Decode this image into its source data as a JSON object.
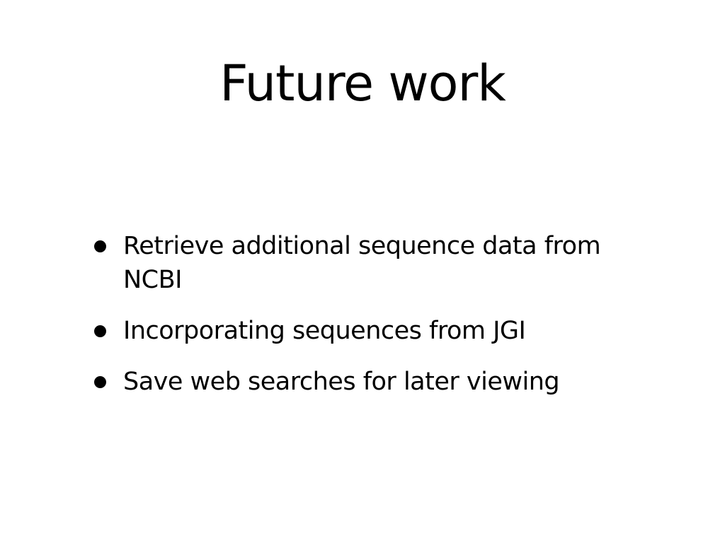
{
  "slide": {
    "title": "Future work",
    "bullets": [
      {
        "text": "Retrieve additional sequence data from NCBI"
      },
      {
        "text": "Incorporating sequences from JGI"
      },
      {
        "text": "Save web searches for later viewing"
      }
    ]
  },
  "colors": {
    "background": "#ffffff",
    "text": "#000000"
  }
}
